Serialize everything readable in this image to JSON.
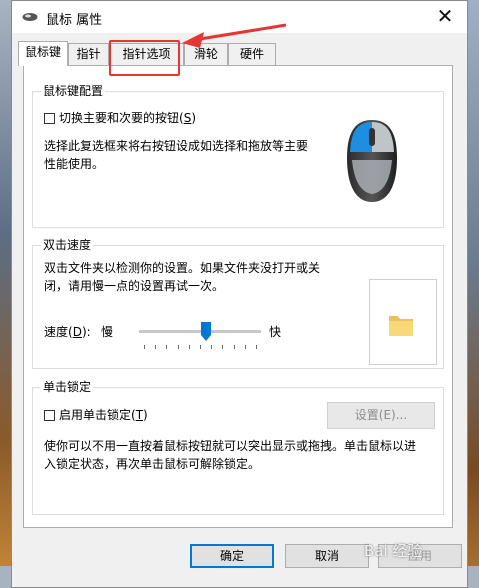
{
  "window": {
    "title": "鼠标 属性",
    "close_glyph": "✕"
  },
  "tabs": [
    {
      "label": "鼠标键"
    },
    {
      "label": "指针"
    },
    {
      "label": "指针选项"
    },
    {
      "label": "滑轮"
    },
    {
      "label": "硬件"
    }
  ],
  "button_config": {
    "title": "鼠标键配置",
    "checkbox_label": "切换主要和次要的按钮(",
    "checkbox_key": "S",
    "checkbox_close": ")",
    "description_line1": "选择此复选框来将右按钮设成如选择和拖放等主要",
    "description_line2": "性能使用。"
  },
  "double_click": {
    "title": "双击速度",
    "description_line1": "双击文件夹以检测你的设置。如果文件夹没打开或关",
    "description_line2": "闭，请用慢一点的设置再试一次。",
    "speed_label": "速度(",
    "speed_key": "D",
    "speed_close": "):",
    "slow": "慢",
    "fast": "快",
    "slider_value_fraction": 0.55
  },
  "click_lock": {
    "title": "单击锁定",
    "checkbox_label": "启用单击锁定(",
    "checkbox_key": "T",
    "checkbox_close": ")",
    "settings_button": "设置(E)...",
    "description_line1": "使你可以不用一直按着鼠标按钮就可以突出显示或拖拽。单击鼠标以进",
    "description_line2": "入锁定状态，再次单击鼠标可解除锁定。"
  },
  "footer": {
    "ok": "确定",
    "cancel": "取消",
    "apply": "应用"
  },
  "watermark": "Bai 经验",
  "colors": {
    "accent": "#0078d7",
    "annotation_red": "#e53535",
    "mouse_blue": "#1e8fe0"
  }
}
